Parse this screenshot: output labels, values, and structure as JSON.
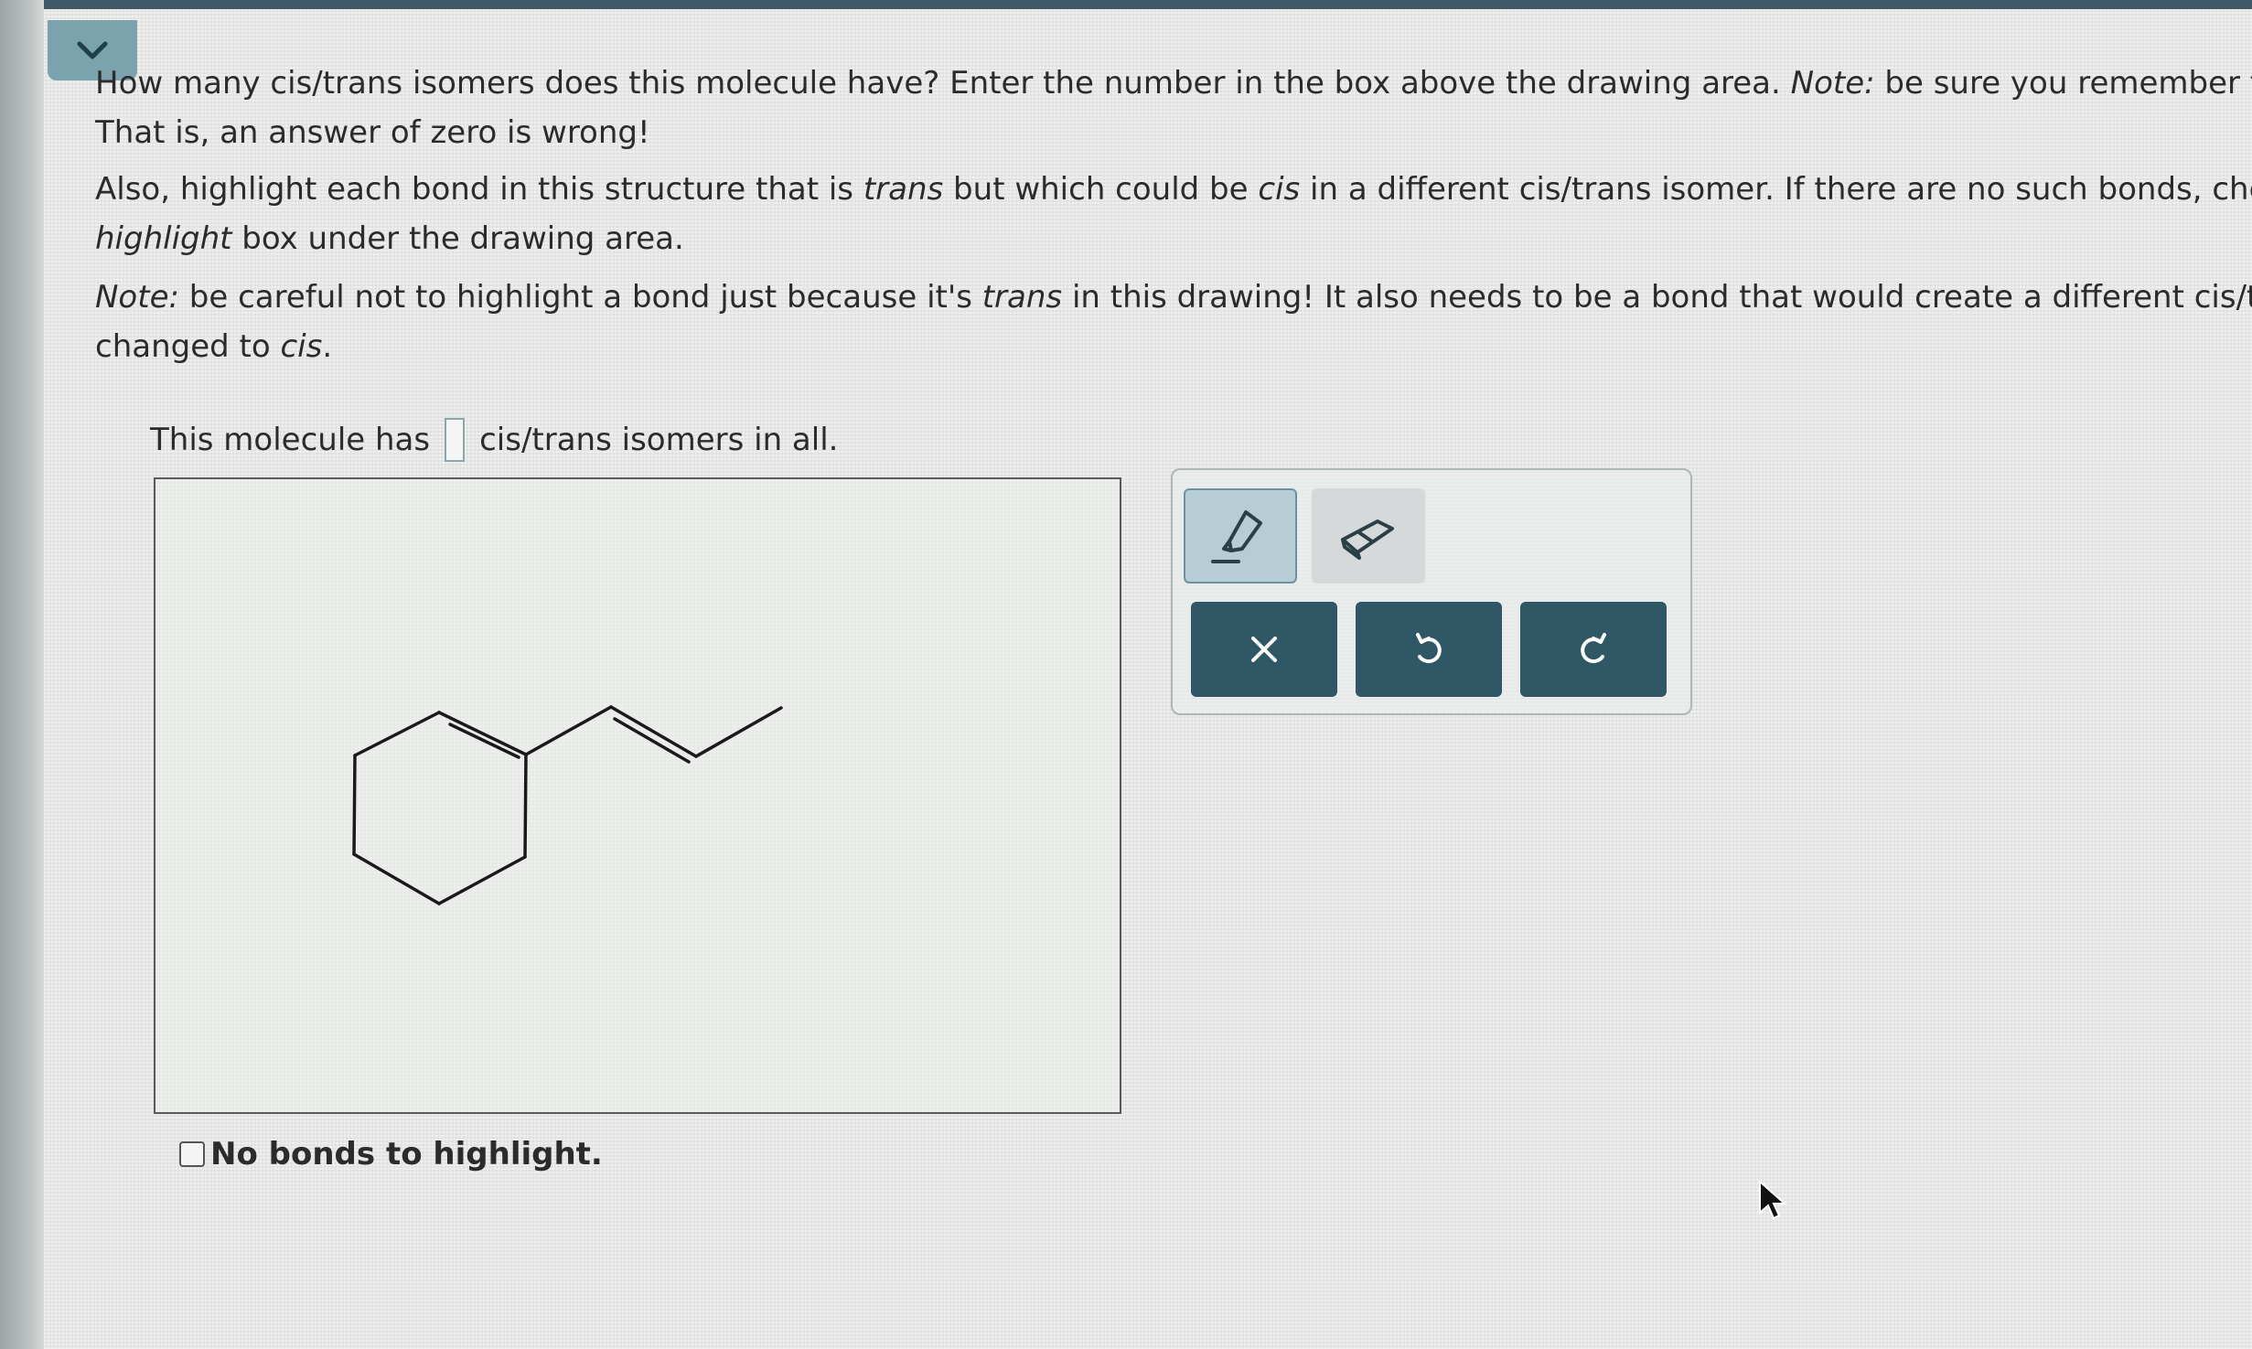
{
  "colors": {
    "accent": "#2f5766",
    "tab": "#7aa3ad",
    "highlighter_active": "#b6cdd4"
  },
  "header": {
    "collapse_icon": "chevron-down-icon"
  },
  "question": {
    "p1_a": "How many cis/trans isomers does this molecule have? Enter the number in the box above the drawing area. ",
    "p1_note": "Note:",
    "p1_b": " be sure you remember to",
    "p1_line2": "That is, an answer of zero is wrong!",
    "p2_a": "Also, highlight each bond in this structure that is ",
    "p2_trans": "trans",
    "p2_b": " but which could be ",
    "p2_cis": "cis",
    "p2_c": " in a different cis/trans isomer. If there are no such bonds, chec",
    "p2_highlight": "highlight",
    "p2_line2": " box under the drawing area.",
    "p3_note": "Note:",
    "p3_a": " be careful not to highlight a bond just because it's ",
    "p3_trans": "trans",
    "p3_b": " in this drawing! It also needs to be a bond that would create a different cis/tra",
    "p3_line2_a": "changed to ",
    "p3_cis": "cis",
    "p3_line2_b": "."
  },
  "answer": {
    "prefix": "This molecule has",
    "value": "",
    "suffix": "cis/trans isomers in all."
  },
  "drawing": {
    "molecule": "1-(but-2-enyl)cyclohexene skeletal structure"
  },
  "no_bonds": {
    "label": "No bonds to highlight.",
    "checked": false
  },
  "toolbar": {
    "tools": [
      {
        "name": "highlighter",
        "icon": "highlighter-icon",
        "active": true
      },
      {
        "name": "eraser",
        "icon": "eraser-icon",
        "active": false
      }
    ],
    "actions": [
      {
        "name": "clear",
        "icon": "close-icon"
      },
      {
        "name": "undo",
        "icon": "undo-icon"
      },
      {
        "name": "redo",
        "icon": "redo-icon"
      }
    ]
  }
}
